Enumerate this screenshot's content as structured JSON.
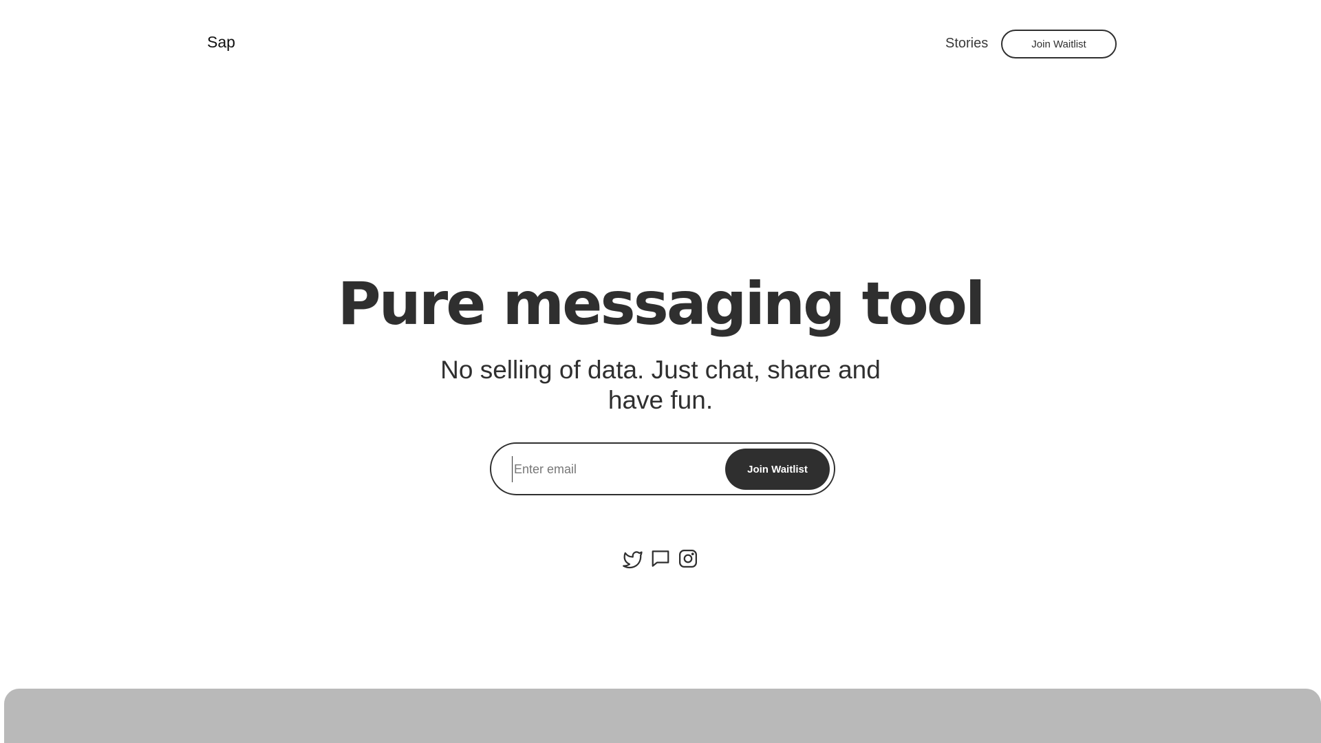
{
  "header": {
    "brand": "Sap",
    "nav_link": "Stories",
    "nav_button": "Join Waitlist"
  },
  "hero": {
    "title": "Pure messaging tool",
    "subtitle": "No selling of data. Just chat, share and have fun."
  },
  "signup": {
    "email_placeholder": "Enter email",
    "email_value": "",
    "submit_label": "Join Waitlist"
  },
  "socials": [
    {
      "icon": "twitter-icon"
    },
    {
      "icon": "chat-icon"
    },
    {
      "icon": "instagram-icon"
    }
  ],
  "colors": {
    "text": "#2f2f2f",
    "button_bg": "#2f2f2f",
    "preview_panel": "#b9b9b9",
    "background": "#ffffff"
  }
}
